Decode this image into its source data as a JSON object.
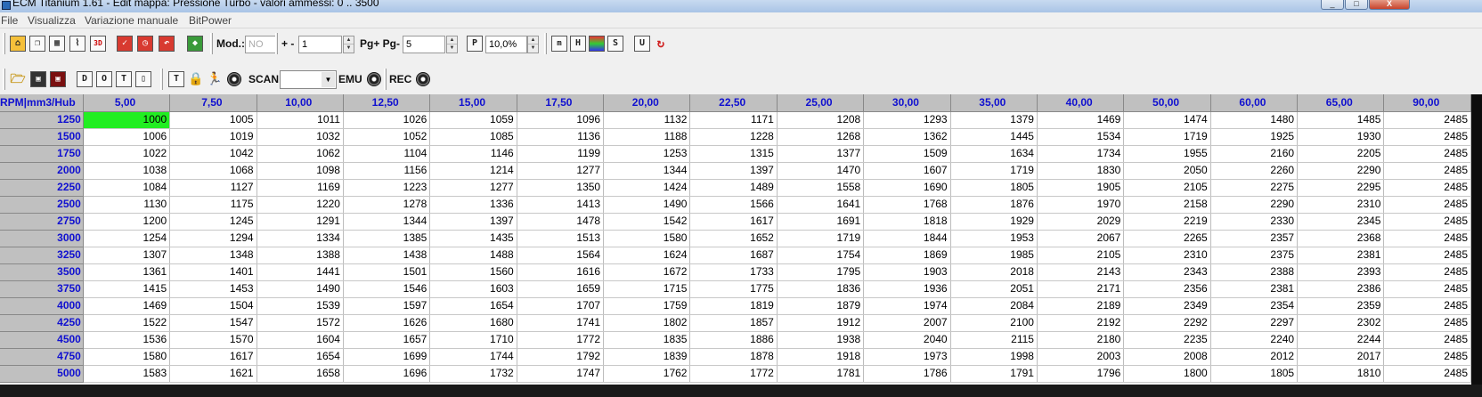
{
  "window": {
    "title": "ECM Titanium 1.61 - Edit mappa: Pressione Turbo - valori ammessi: 0 .. 3500",
    "controls": [
      "_",
      "□",
      "X"
    ]
  },
  "menu": [
    "File",
    "Visualizza",
    "Variazione manuale",
    "BitPower"
  ],
  "toolbar1": {
    "mod_label": "Mod.:",
    "mod_value": "NO",
    "step_label": "+ -",
    "step_value": "1",
    "page_label": "Pg+ Pg-",
    "page_value": "5",
    "p_button": "P",
    "percent_value": "10,0%"
  },
  "toolbar2": {
    "scan_label": "SCAN",
    "scan_value": "",
    "emu_label": "EMU",
    "rec_label": "REC"
  },
  "icons": {
    "tb1": [
      "home-icon",
      "copy-window-icon",
      "table-view-icon",
      "2d-graph-icon",
      "3d-view-icon",
      "checkmark-icon",
      "clock-icon",
      "undo-icon",
      "cube-icon"
    ],
    "tb1_right": [
      "m-icon",
      "h-icon",
      "color-map-icon",
      "s-icon",
      "u-icon",
      "refresh-red-icon"
    ],
    "tb2": [
      "open-folder-icon",
      "save-icon",
      "save-as-icon",
      "d-icon",
      "o-icon",
      "t-icon",
      "panel-icon",
      "monitor-icon",
      "lock-icon",
      "run-icon",
      "disc-icon"
    ]
  },
  "colors": {
    "selected_cell": "#22ee22",
    "header_bg": "#c0c0c0",
    "header_text": "#1010d0"
  },
  "grid": {
    "corner_label": "RPM|mm3/Hub",
    "columns": [
      "5,00",
      "7,50",
      "10,00",
      "12,50",
      "15,00",
      "17,50",
      "20,00",
      "22,50",
      "25,00",
      "30,00",
      "35,00",
      "40,00",
      "50,00",
      "60,00",
      "65,00",
      "90,00"
    ],
    "selected": {
      "row": 0,
      "col": 0
    },
    "rows": [
      {
        "rpm": "1250",
        "values": [
          "1000",
          "1005",
          "1011",
          "1026",
          "1059",
          "1096",
          "1132",
          "1171",
          "1208",
          "1293",
          "1379",
          "1469",
          "1474",
          "1480",
          "1485",
          "2485"
        ]
      },
      {
        "rpm": "1500",
        "values": [
          "1006",
          "1019",
          "1032",
          "1052",
          "1085",
          "1136",
          "1188",
          "1228",
          "1268",
          "1362",
          "1445",
          "1534",
          "1719",
          "1925",
          "1930",
          "2485"
        ]
      },
      {
        "rpm": "1750",
        "values": [
          "1022",
          "1042",
          "1062",
          "1104",
          "1146",
          "1199",
          "1253",
          "1315",
          "1377",
          "1509",
          "1634",
          "1734",
          "1955",
          "2160",
          "2205",
          "2485"
        ]
      },
      {
        "rpm": "2000",
        "values": [
          "1038",
          "1068",
          "1098",
          "1156",
          "1214",
          "1277",
          "1344",
          "1397",
          "1470",
          "1607",
          "1719",
          "1830",
          "2050",
          "2260",
          "2290",
          "2485"
        ]
      },
      {
        "rpm": "2250",
        "values": [
          "1084",
          "1127",
          "1169",
          "1223",
          "1277",
          "1350",
          "1424",
          "1489",
          "1558",
          "1690",
          "1805",
          "1905",
          "2105",
          "2275",
          "2295",
          "2485"
        ]
      },
      {
        "rpm": "2500",
        "values": [
          "1130",
          "1175",
          "1220",
          "1278",
          "1336",
          "1413",
          "1490",
          "1566",
          "1641",
          "1768",
          "1876",
          "1970",
          "2158",
          "2290",
          "2310",
          "2485"
        ]
      },
      {
        "rpm": "2750",
        "values": [
          "1200",
          "1245",
          "1291",
          "1344",
          "1397",
          "1478",
          "1542",
          "1617",
          "1691",
          "1818",
          "1929",
          "2029",
          "2219",
          "2330",
          "2345",
          "2485"
        ]
      },
      {
        "rpm": "3000",
        "values": [
          "1254",
          "1294",
          "1334",
          "1385",
          "1435",
          "1513",
          "1580",
          "1652",
          "1719",
          "1844",
          "1953",
          "2067",
          "2265",
          "2357",
          "2368",
          "2485"
        ]
      },
      {
        "rpm": "3250",
        "values": [
          "1307",
          "1348",
          "1388",
          "1438",
          "1488",
          "1564",
          "1624",
          "1687",
          "1754",
          "1869",
          "1985",
          "2105",
          "2310",
          "2375",
          "2381",
          "2485"
        ]
      },
      {
        "rpm": "3500",
        "values": [
          "1361",
          "1401",
          "1441",
          "1501",
          "1560",
          "1616",
          "1672",
          "1733",
          "1795",
          "1903",
          "2018",
          "2143",
          "2343",
          "2388",
          "2393",
          "2485"
        ]
      },
      {
        "rpm": "3750",
        "values": [
          "1415",
          "1453",
          "1490",
          "1546",
          "1603",
          "1659",
          "1715",
          "1775",
          "1836",
          "1936",
          "2051",
          "2171",
          "2356",
          "2381",
          "2386",
          "2485"
        ]
      },
      {
        "rpm": "4000",
        "values": [
          "1469",
          "1504",
          "1539",
          "1597",
          "1654",
          "1707",
          "1759",
          "1819",
          "1879",
          "1974",
          "2084",
          "2189",
          "2349",
          "2354",
          "2359",
          "2485"
        ]
      },
      {
        "rpm": "4250",
        "values": [
          "1522",
          "1547",
          "1572",
          "1626",
          "1680",
          "1741",
          "1802",
          "1857",
          "1912",
          "2007",
          "2100",
          "2192",
          "2292",
          "2297",
          "2302",
          "2485"
        ]
      },
      {
        "rpm": "4500",
        "values": [
          "1536",
          "1570",
          "1604",
          "1657",
          "1710",
          "1772",
          "1835",
          "1886",
          "1938",
          "2040",
          "2115",
          "2180",
          "2235",
          "2240",
          "2244",
          "2485"
        ]
      },
      {
        "rpm": "4750",
        "values": [
          "1580",
          "1617",
          "1654",
          "1699",
          "1744",
          "1792",
          "1839",
          "1878",
          "1918",
          "1973",
          "1998",
          "2003",
          "2008",
          "2012",
          "2017",
          "2485"
        ]
      },
      {
        "rpm": "5000",
        "values": [
          "1583",
          "1621",
          "1658",
          "1696",
          "1732",
          "1747",
          "1762",
          "1772",
          "1781",
          "1786",
          "1791",
          "1796",
          "1800",
          "1805",
          "1810",
          "2485"
        ]
      }
    ]
  }
}
